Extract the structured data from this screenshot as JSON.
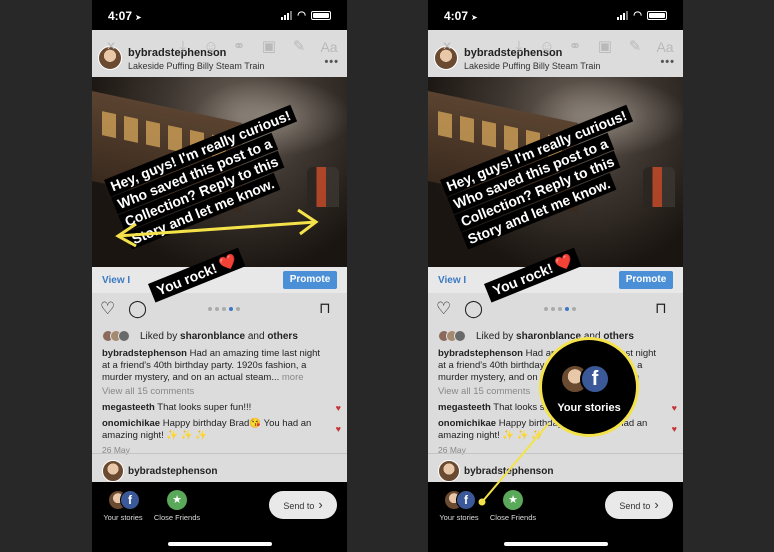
{
  "colors": {
    "highlight": "#f4e24a",
    "link": "#3b79c2",
    "promote": "#4b8fd6",
    "heart": "#c8343a"
  },
  "status": {
    "time": "4:07"
  },
  "post": {
    "username": "bybradstephenson",
    "location": "Lakeside Puffing Billy Steam Train",
    "view_insights": "View I",
    "promote": "Promote",
    "likes_prefix": "Liked by ",
    "likes_user": "sharonblance",
    "likes_and": " and ",
    "likes_others": "others",
    "caption_user": "bybradstephenson",
    "caption_text": " Had an amazing time last night at a friend's 40th birthday party. 1920s fashion, a murder mystery, and on an actual steam...",
    "caption_more": " more",
    "view_all": "View all 15 comments",
    "c1_user": "megasteeth",
    "c1_text": " That looks super fun!!!",
    "c2_user": "onomichikae",
    "c2_text": " Happy birthday Brad😘 You had an amazing night! ✨ ✨ ✨",
    "date": "26 May",
    "next_user": "bybradstephenson"
  },
  "story_text": {
    "lines": [
      "Hey, guys! I'm really curious!",
      "Who saved this post to a",
      "Collection? Reply to this",
      "Story and let me know."
    ],
    "sticker": "You rock! ❤️"
  },
  "share": {
    "your_stories": "Your stories",
    "close_friends": "Close Friends",
    "send_to": "Send to"
  },
  "icons": {
    "close": "×",
    "save": "⤓",
    "sticker": "☺",
    "link": "🔗",
    "stick2": "▣",
    "pen": "✎",
    "text": "Aa",
    "heart": "♡",
    "comment": "◯",
    "bookmark": "⊓",
    "more": "•••",
    "chevron": "›",
    "star": "★",
    "facebook": "f"
  },
  "zoom": {
    "label": "Your stories"
  }
}
